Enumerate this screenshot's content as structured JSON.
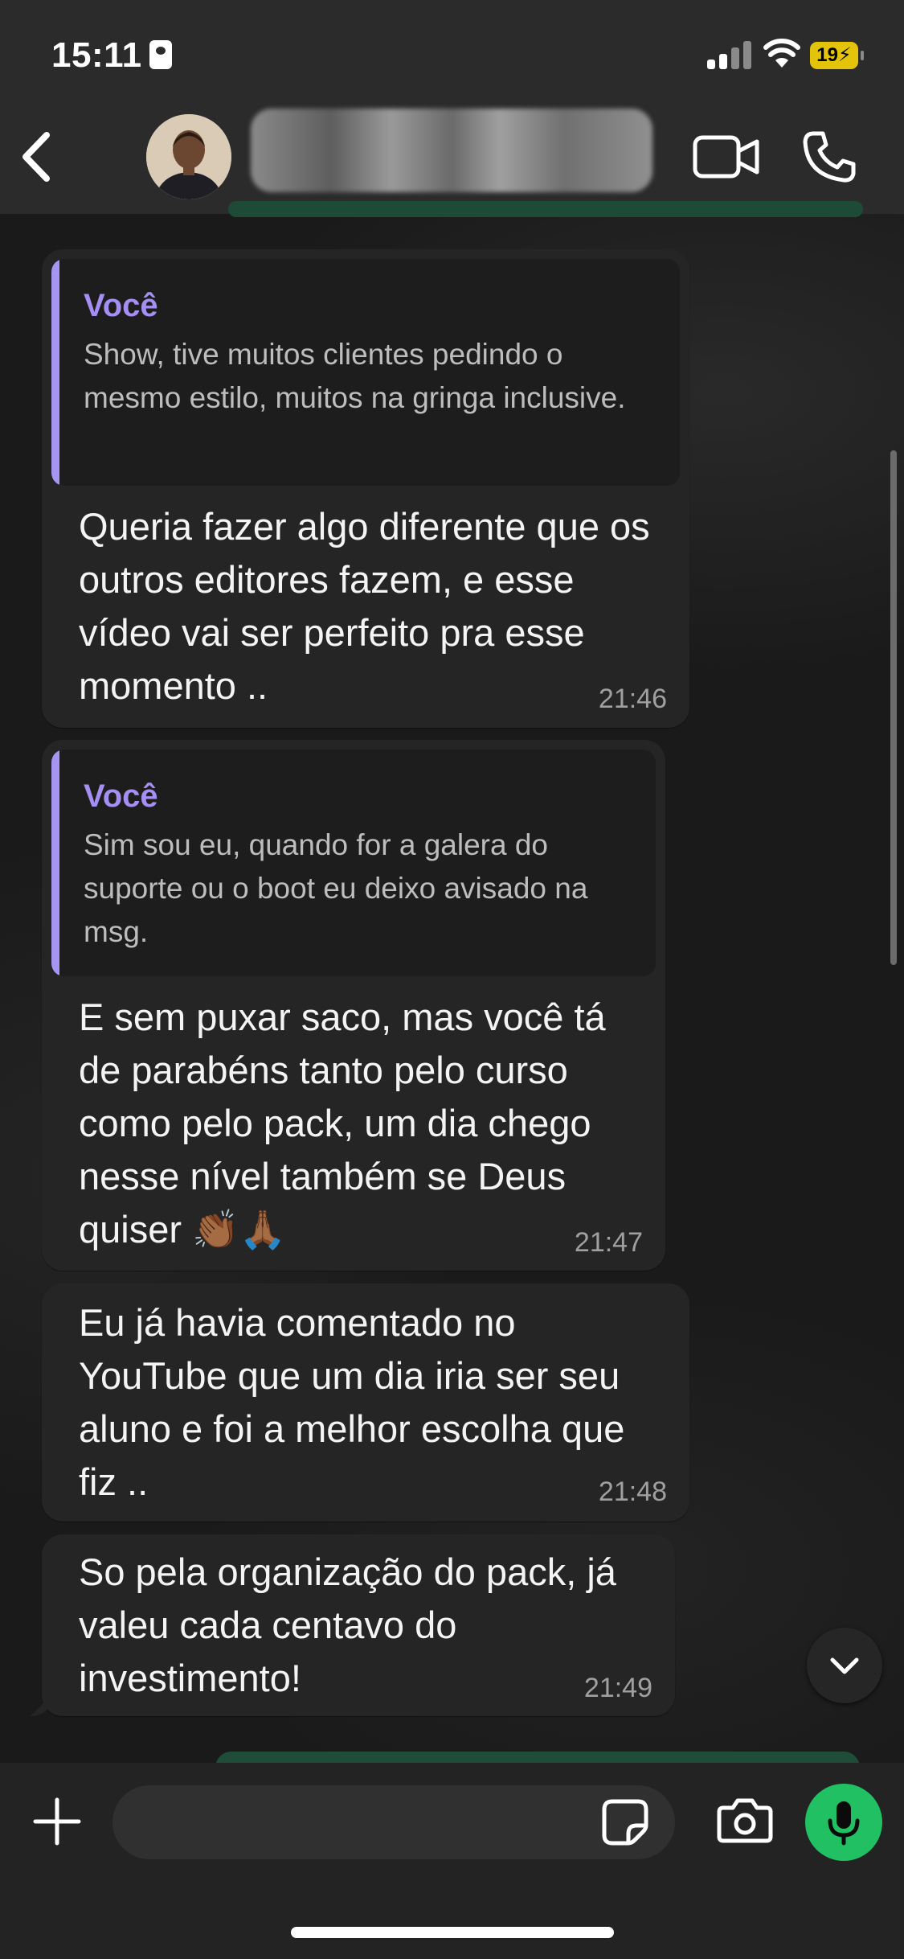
{
  "status_bar": {
    "time": "15:11",
    "battery": "19"
  },
  "header": {
    "back_icon": "chevron-left-icon",
    "contact_name": "",
    "video_icon": "video-camera-icon",
    "call_icon": "phone-icon"
  },
  "messages": [
    {
      "quote_author": "Você",
      "quote_text": "Show, tive muitos clientes pedindo o mesmo estilo, muitos na gringa inclusive.",
      "text": "Queria fazer algo diferente que os outros editores fazem, e esse vídeo vai ser perfeito pra esse momento ..",
      "time": "21:46"
    },
    {
      "quote_author": "Você",
      "quote_text": "Sim sou eu, quando for a galera do suporte ou o boot eu deixo avisado na msg.",
      "text": "E sem puxar saco, mas você tá de parabéns tanto pelo curso como pelo pack, um dia chego nesse nível também se Deus quiser 👏🏾🙏🏾",
      "time": "21:47"
    },
    {
      "text": "Eu já havia comentado no YouTube que um dia iria ser seu aluno e foi a melhor escolha que fiz ..",
      "time": "21:48"
    },
    {
      "text": "So pela organização do pack, já valeu cada centavo do investimento!",
      "time": "21:49"
    }
  ],
  "composer": {
    "placeholder": "",
    "plus_icon": "plus-icon",
    "sticker_icon": "sticker-icon",
    "camera_icon": "camera-icon",
    "mic_icon": "microphone-icon"
  },
  "colors": {
    "quote_accent": "#a795f4",
    "bubble_incoming": "#252525",
    "mic_button": "#21c063",
    "battery_fill": "#e3c40a"
  }
}
